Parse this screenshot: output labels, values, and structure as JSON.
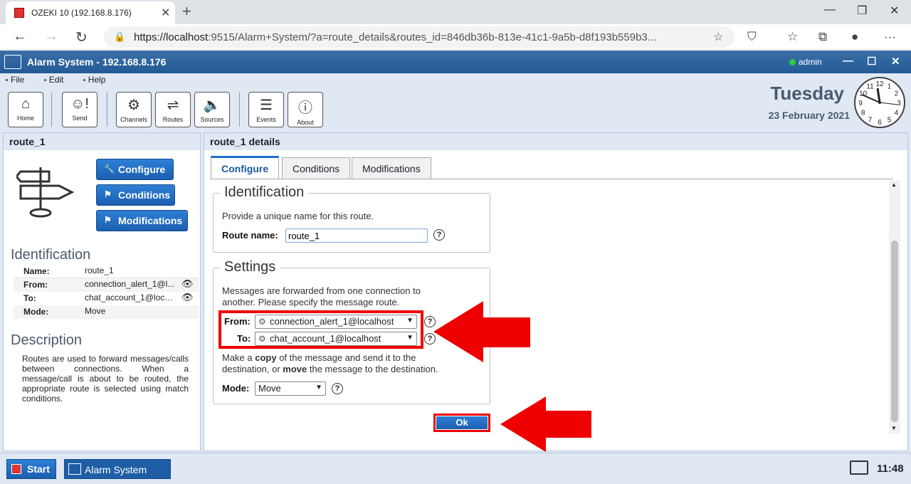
{
  "browser": {
    "tab_title": "OZEKI 10 (192.168.8.176)",
    "url_prefix": "https://localhost",
    "url_rest": ":9515/Alarm+System/?a=route_details&routes_id=846db36b-813e-41c1-9a5b-d8f193b559b3..."
  },
  "app": {
    "title": "Alarm System - 192.168.8.176",
    "user": "admin",
    "menu": [
      "File",
      "Edit",
      "Help"
    ],
    "toolbar": {
      "home": "Home",
      "send": "Send",
      "channels": "Channels",
      "routes": "Routes",
      "sources": "Sources",
      "events": "Events",
      "about": "About"
    },
    "day": "Tuesday",
    "date": "23 February 2021",
    "clock_numbers": [
      "12",
      "1",
      "2",
      "3",
      "4",
      "5",
      "6",
      "7",
      "8",
      "9",
      "10",
      "11"
    ]
  },
  "left": {
    "header": "route_1",
    "buttons": {
      "configure": "Configure",
      "conditions": "Conditions",
      "modifications": "Modifications"
    },
    "identification_title": "Identification",
    "fields": {
      "name_k": "Name:",
      "name_v": "route_1",
      "from_k": "From:",
      "from_v": "connection_alert_1@l...",
      "to_k": "To:",
      "to_v": "chat_account_1@local...",
      "mode_k": "Mode:",
      "mode_v": "Move"
    },
    "description_title": "Description",
    "description": "Routes are used to forward messages/calls between connections. When a message/call is about to be routed, the appropriate route is selected using match conditions."
  },
  "right": {
    "header": "route_1 details",
    "tabs": {
      "configure": "Configure",
      "conditions": "Conditions",
      "modifications": "Modifications"
    },
    "identification": {
      "legend": "Identification",
      "hint": "Provide a unique name for this route.",
      "route_name_label": "Route name:",
      "route_name_value": "route_1"
    },
    "settings": {
      "legend": "Settings",
      "hint1": "Messages are forwarded from one connection to",
      "hint2": "another. Please specify the message route.",
      "from_label": "From:",
      "from_value": "connection_alert_1@localhost",
      "to_label": "To:",
      "to_value": "chat_account_1@localhost",
      "copy_1": "Make a ",
      "copy_b": "copy",
      "copy_2": " of the message and send it to the",
      "move_1": "destination, or ",
      "move_b": "move",
      "move_2": " the message to the destination.",
      "mode_label": "Mode:",
      "mode_value": "Move"
    },
    "ok": "Ok"
  },
  "taskbar": {
    "start": "Start",
    "item": "Alarm System",
    "time": "11:48"
  },
  "colors": {
    "accent": "#1f6fca",
    "highlight": "#ee0000"
  }
}
